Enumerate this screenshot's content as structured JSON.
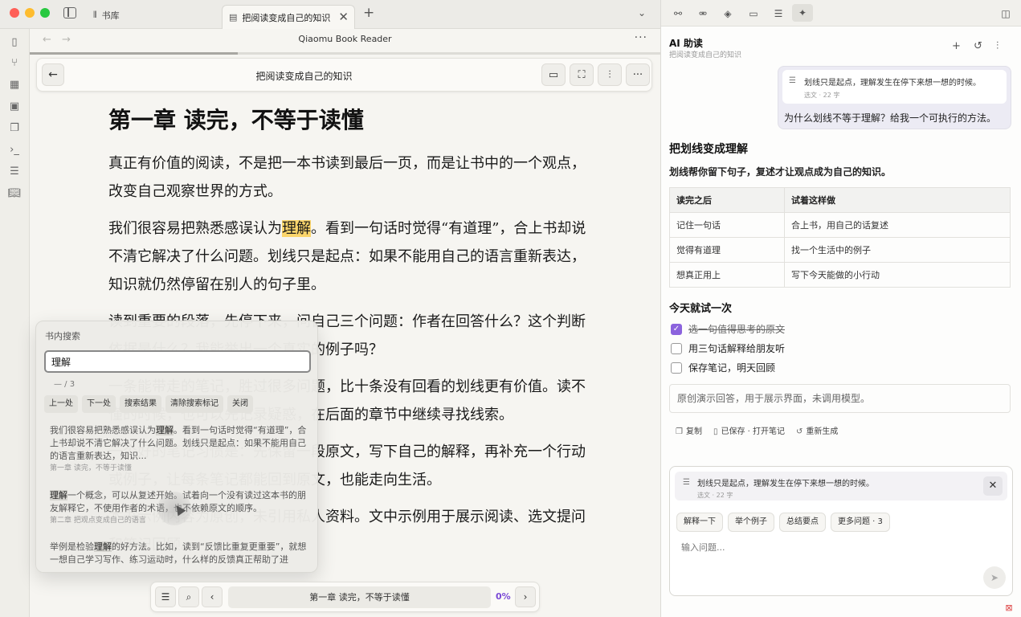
{
  "tabs": {
    "library_icon": "library-icon",
    "library_label": "书库",
    "book_icon": "book-icon",
    "book_label": "把阅读变成自己的知识",
    "close_glyph": "✕",
    "new_glyph": "+"
  },
  "nav": {
    "app_title": "Qiaomu Book Reader",
    "back_glyph": "←",
    "forward_glyph": "→",
    "more_glyph": "···"
  },
  "reader_toolbar": {
    "back_glyph": "←",
    "title": "把阅读变成自己的知识"
  },
  "content": {
    "chapter_title": "第一章 读完，不等于读懂",
    "p1": "真正有价值的阅读，不是把一本书读到最后一页，而是让书中的一个观点，改变自己观察世界的方式。",
    "p2_before": "我们很容易把熟悉感误认为",
    "p2_highlight": "理解",
    "p2_after": "。看到一句话时觉得“有道理”，合上书却说不清它解决了什么问题。划线只是起点：如果不能用自己的语言重新表达，知识就仍然停留在别人的句子里。",
    "p3": "读到重要的段落，先停下来，问自己三个问题：作者在回答什么？这个判断依据是什么？我能举出一个真实的例子吗？",
    "p4": "一条能带走的笔记，胜过很多问题，比十条没有回看的划线更有价值。读不懂的时候，也可以先记录疑惑，在后面的章节中继续寻找线索。",
    "p5": "一个好的笔记习惯是：先保留一段原文，写下自己的解释，再补充一个行动或例子，让每条笔记都能回到原文，也能走向生活。",
    "p6": "本书示例内容为原创，未引用私人资料。文中示例用于展示阅读、选文提问和笔记回顾。"
  },
  "search": {
    "title": "书内搜索",
    "query": "理解",
    "count": "— / 3",
    "actions": [
      "上一处",
      "下一处",
      "搜索结果",
      "清除搜索标记",
      "关闭"
    ],
    "results": [
      {
        "before": "我们很容易把熟悉感误认为",
        "hit": "理解",
        "after": "。看到一句话时觉得“有道理”，合上书却说不清它解决了什么问题。划线只是起点：如果不能用自己的语言重新表达，知识...",
        "meta": "第一章 读完，不等于读懂"
      },
      {
        "before": "",
        "hit": "理解",
        "after": "一个概念，可以从复述开始。试着向一个没有读过这本书的朋友解释它，不使用作者的术语，也不依赖原文的顺序。",
        "meta": "第二章 把观点变成自己的语言"
      },
      {
        "before": "举例是检验",
        "hit": "理解",
        "after": "的好方法。比如，读到“反馈比重复更重要”，就想一想自己学习写作、练习运动时，什么样的反馈真正帮助了进",
        "meta": ""
      }
    ]
  },
  "bottom_bar": {
    "chapter": "第一章 读完，不等于读懂",
    "percent": "0%",
    "prev_glyph": "‹",
    "next_glyph": "›"
  },
  "ai_panel": {
    "title": "AI 助读",
    "subtitle": "把阅读变成自己的知识",
    "new_glyph": "+",
    "quote": {
      "text": "划线只是起点，理解发生在停下来想一想的时候。",
      "meta": "选文 · 22 字"
    },
    "user_question": "为什么划线不等于理解？给我一个可执行的方法。",
    "answer": {
      "heading": "把划线变成理解",
      "lead": "划线帮你留下句子，复述才让观点成为自己的知识。",
      "table_headers": [
        "读完之后",
        "试着这样做"
      ],
      "table_rows": [
        [
          "记住一句话",
          "合上书，用自己的话复述"
        ],
        [
          "觉得有道理",
          "找一个生活中的例子"
        ],
        [
          "想真正用上",
          "写下今天能做的小行动"
        ]
      ],
      "todo_heading": "今天就试一次",
      "todos": [
        {
          "label": "选一句值得思考的原文",
          "done": true
        },
        {
          "label": "用三句话解释给朋友听",
          "done": false
        },
        {
          "label": "保存笔记，明天回顾",
          "done": false
        }
      ],
      "note": "原创演示回答，用于展示界面，未调用模型。",
      "actions": {
        "copy": "复制",
        "saved": "已保存 · 打开笔记",
        "regenerate": "重新生成"
      }
    },
    "composer": {
      "quote_text": "划线只是起点，理解发生在停下来想一想的时候。",
      "quote_meta": "选文 · 22 字",
      "close_glyph": "✕",
      "chips": [
        "解释一下",
        "举个例子",
        "总结要点",
        "更多问题 · 3"
      ],
      "placeholder": "输入问题..."
    }
  },
  "colors": {
    "highlight": "#fbd56b",
    "accent": "#8b63dd",
    "percent": "#7b4ad6"
  }
}
